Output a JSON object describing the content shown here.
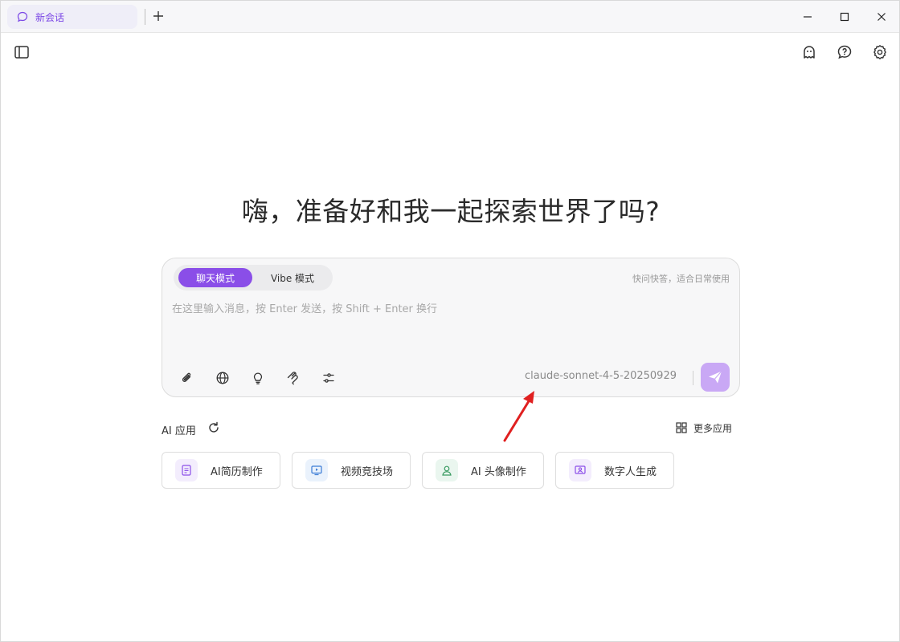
{
  "tab": {
    "label": "新会话"
  },
  "headline": "嗨，准备好和我一起探索世界了吗?",
  "composer": {
    "modes": [
      "聊天模式",
      "Vibe 模式"
    ],
    "mode_hint": "快问快答，适合日常使用",
    "placeholder": "在这里输入消息，按 Enter 发送，按 Shift + Enter 换行",
    "model": "claude-sonnet-4-5-20250929"
  },
  "apps": {
    "title": "AI 应用",
    "more_label": "更多应用",
    "items": [
      {
        "label": "AI简历制作",
        "icon": "resume-icon"
      },
      {
        "label": "视频竞技场",
        "icon": "video-icon"
      },
      {
        "label": "AI 头像制作",
        "icon": "avatar-icon"
      },
      {
        "label": "数字人生成",
        "icon": "digital-human-icon"
      }
    ]
  },
  "colors": {
    "accent": "#8a4ee8",
    "send_button": "#c9a8f5",
    "arrow": "#e02020"
  }
}
